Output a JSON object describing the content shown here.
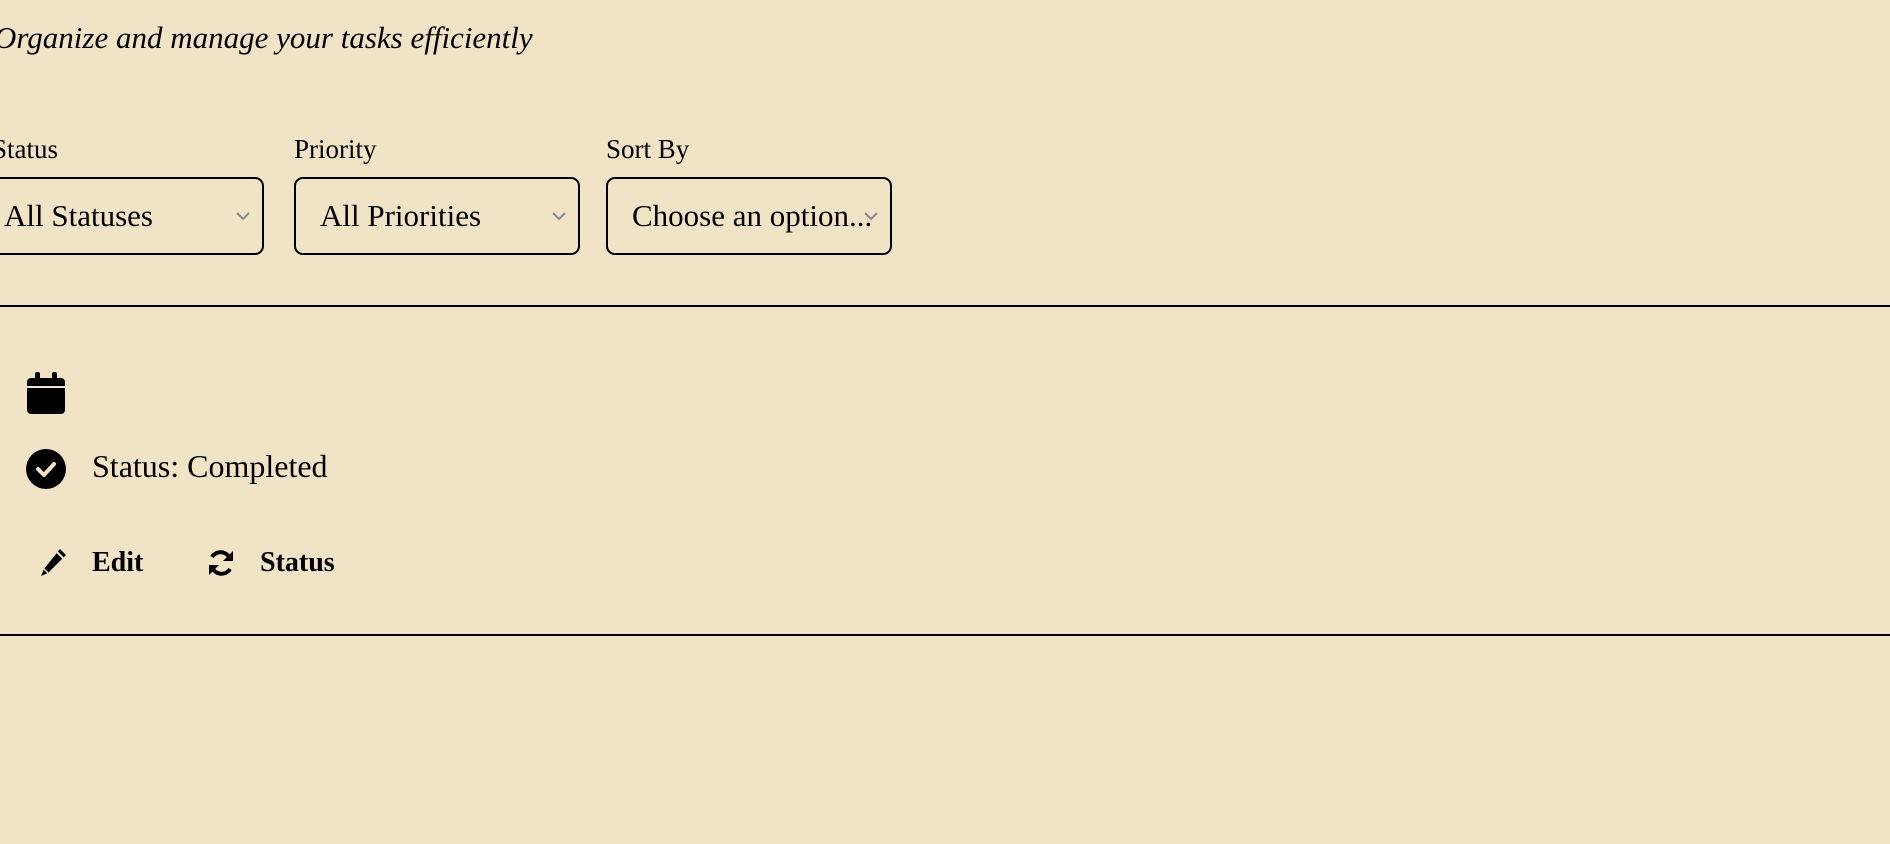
{
  "header": {
    "subtitle": "Organize and manage your tasks efficiently"
  },
  "filters": {
    "status": {
      "label": "Status",
      "value": "All Statuses"
    },
    "priority": {
      "label": "Priority",
      "value": "All Priorities"
    },
    "sort": {
      "label": "Sort By",
      "value": "Choose an option..."
    }
  },
  "task": {
    "date_icon": "calendar-icon",
    "status_icon": "check-circle-icon",
    "status_text": "Status: Completed",
    "actions": {
      "edit": {
        "label": "Edit",
        "icon": "pencil-icon"
      },
      "status": {
        "label": "Status",
        "icon": "refresh-icon"
      }
    }
  },
  "colors": {
    "background": "#f1e3c5",
    "foreground": "#000000",
    "chevron": "#8a8a8a"
  }
}
